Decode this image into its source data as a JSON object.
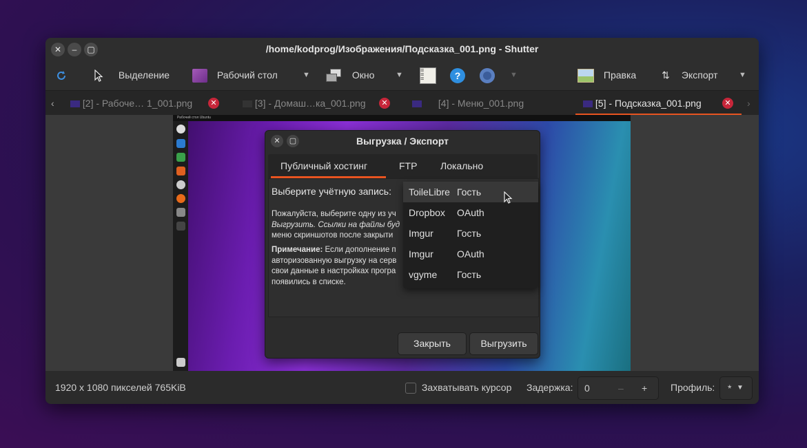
{
  "window": {
    "title": "/home/kodprog/Изображения/Подсказка_001.png - Shutter"
  },
  "toolbar": {
    "selection": "Выделение",
    "desktop": "Рабочий стол",
    "window": "Окно",
    "edit": "Правка",
    "export": "Экспорт"
  },
  "tabs": [
    {
      "label": "[2] - Рабоче…  1_001.png"
    },
    {
      "label": "[3] - Домаш…ка_001.png"
    },
    {
      "label": "[4] - Меню_001.png"
    },
    {
      "label": "[5] - Подсказка_001.png"
    }
  ],
  "screenshot": {
    "top_bar_text": "Рабочий стол Ubuntu"
  },
  "dialog": {
    "title": "Выгрузка / Экспорт",
    "tabs": [
      "Публичный хостинг",
      "FTP",
      "Локально"
    ],
    "account_label": "Выберите учётную запись:",
    "desc_lines": [
      "Пожалуйста, выберите одну из уч",
      "Выгрузить.  Ссылки на файлы буд",
      "меню скриншотов после закрыти"
    ],
    "note_bold": "Примечание:",
    "note_lines": [
      " Если дополнение п",
      "авторизованную выгрузку на серв",
      "свои данные в настройках програ",
      "появились в списке."
    ],
    "accounts": [
      {
        "service": "ToileLibre",
        "type": "Гость"
      },
      {
        "service": "Dropbox",
        "type": "OAuth"
      },
      {
        "service": "Imgur",
        "type": "Гость"
      },
      {
        "service": "Imgur",
        "type": "OAuth"
      },
      {
        "service": "vgyme",
        "type": "Гость"
      }
    ],
    "close_button": "Закрыть",
    "upload_button": "Выгрузить"
  },
  "statusbar": {
    "info": "1920 x 1080 пикселей  765KiB",
    "capture_cursor": "Захватывать курсор",
    "delay_label": "Задержка:",
    "delay_value": "0",
    "profile_label": "Профиль:",
    "profile_value": "*"
  }
}
